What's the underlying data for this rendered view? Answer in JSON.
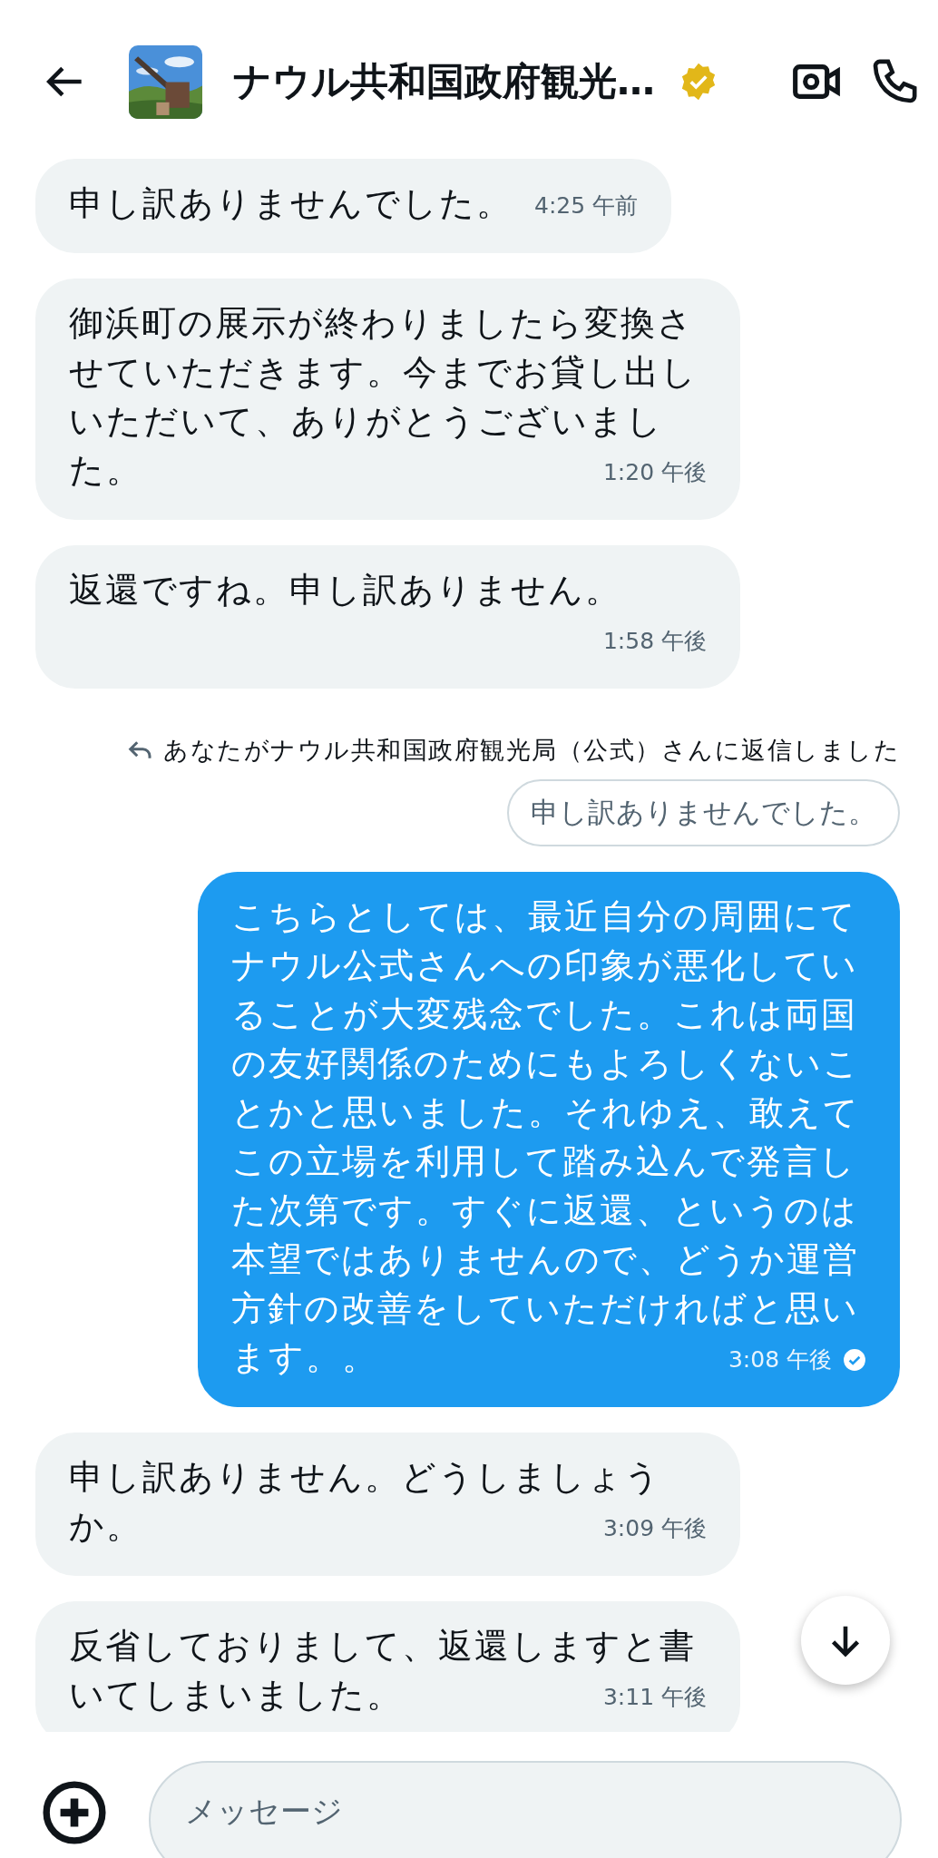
{
  "header": {
    "title": "ナウル共和国政府観光…",
    "verified": true
  },
  "messages": [
    {
      "kind": "received",
      "text": "申し訳ありませんでした。",
      "time": "4:25 午前"
    },
    {
      "kind": "received",
      "text": "御浜町の展示が終わりましたら変換させていただきます。今までお貸し出しいただいて、ありがとうございました。",
      "time": "1:20 午後"
    },
    {
      "kind": "received",
      "text": "返還ですね。申し訳ありません。",
      "time": "1:58 午後"
    },
    {
      "kind": "reply_note",
      "text": "あなたがナウル共和国政府観光局（公式）さんに返信しました"
    },
    {
      "kind": "quote",
      "text": "申し訳ありませんでした。"
    },
    {
      "kind": "sent",
      "text": "こちらとしては、最近自分の周囲にてナウル公式さんへの印象が悪化していることが大変残念でした。これは両国の友好関係のためにもよろしくないことかと思いました。それゆえ、敢えてこの立場を利用して踏み込んで発言した次第です。すぐに返還、というのは本望ではありませんので、どうか運営方針の改善をしていただければと思います。。",
      "time": "3:08 午後",
      "read": true
    },
    {
      "kind": "received",
      "text": "申し訳ありません。どうしましょうか。",
      "time": "3:09 午後"
    },
    {
      "kind": "received",
      "text": "反省しておりまして、返還しますと書いてしまいました。",
      "time": "3:11 午後"
    }
  ],
  "composer": {
    "placeholder": "メッセージ"
  }
}
